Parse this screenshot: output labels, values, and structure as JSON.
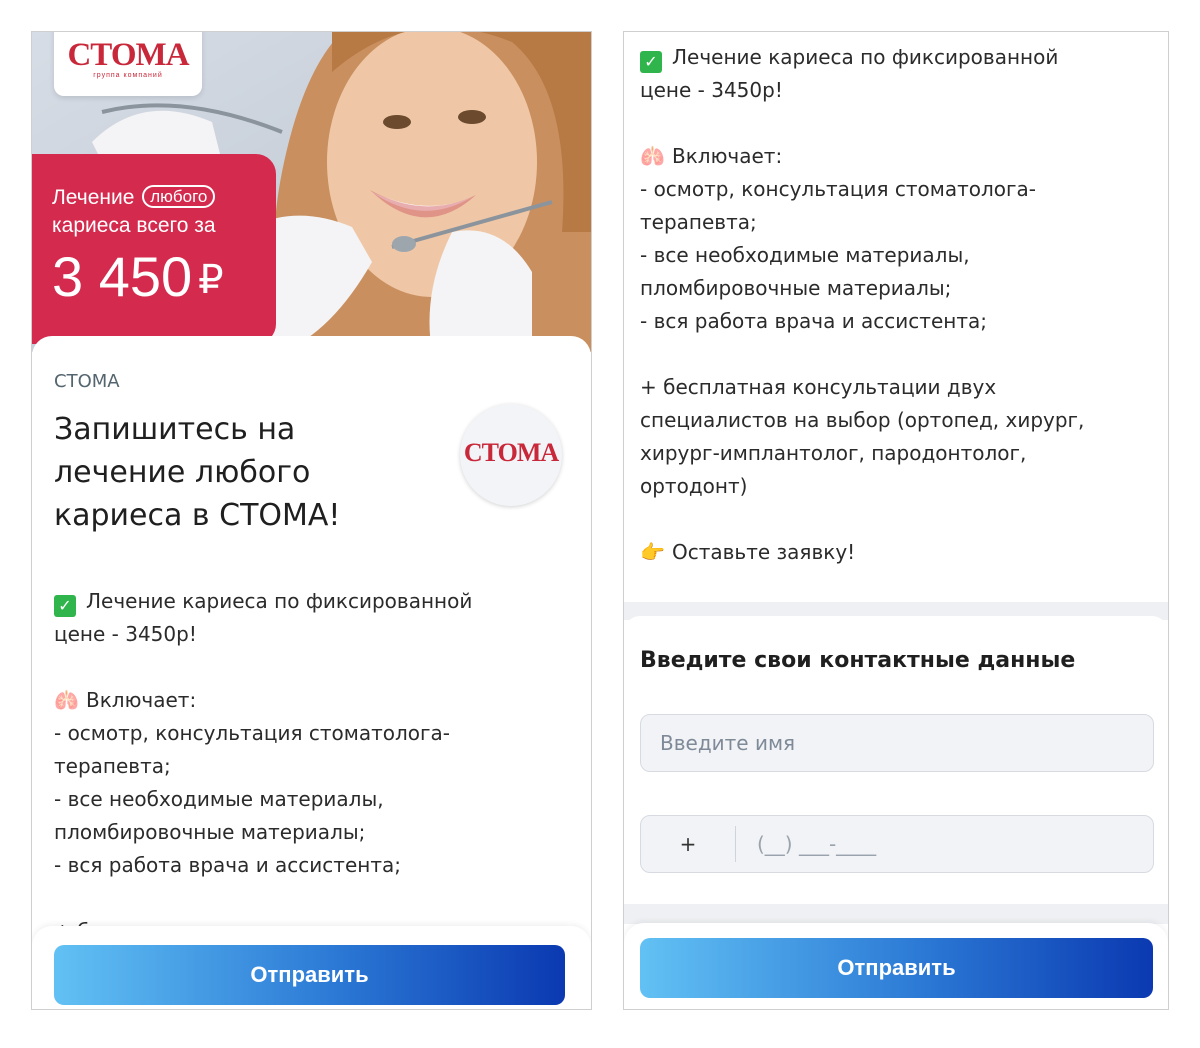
{
  "hero": {
    "logo_text": "СТОМА",
    "logo_subtitle": "группа компаний",
    "promo_line1_word": "Лечение",
    "promo_pill": "любого",
    "promo_line2": "кариеса всего за",
    "promo_price": "3 450",
    "promo_currency": "₽"
  },
  "card": {
    "brand": "СТОМА",
    "headline": "Запишитесь на лечение любого кариеса в СТОМА!",
    "avatar_logo": "СТОМА"
  },
  "description": [
    "Лечение кариеса по фиксированной",
    "цене - 3450р!",
    "",
    "Включает:",
    "- осмотр, консультация стоматолога-",
    "терапевта;",
    "- все необходимые материалы,",
    "пломбировочные материалы;",
    "- вся работа врача и ассистента;",
    "",
    "+ бесплатная консультации двух",
    "специалистов на выбор (ортопед, хирург,",
    "хирург-имплантолог, пародонтолог,",
    "ортодонт)",
    "",
    "Оставьте заявку!"
  ],
  "icons": {
    "check": "✓",
    "lungs": "🫁",
    "hand": "👉"
  },
  "form": {
    "title": "Введите свои контактные данные",
    "name_placeholder": "Введите имя",
    "phone_code": "+",
    "phone_placeholder": "(__) ___-____"
  },
  "submit_label": "Отправить",
  "colors": {
    "promo_red": "#d42a4e",
    "brand_red": "#c8283a",
    "check_green": "#2fb54b",
    "button_start": "#62c1f4",
    "button_end": "#0b39b1"
  }
}
